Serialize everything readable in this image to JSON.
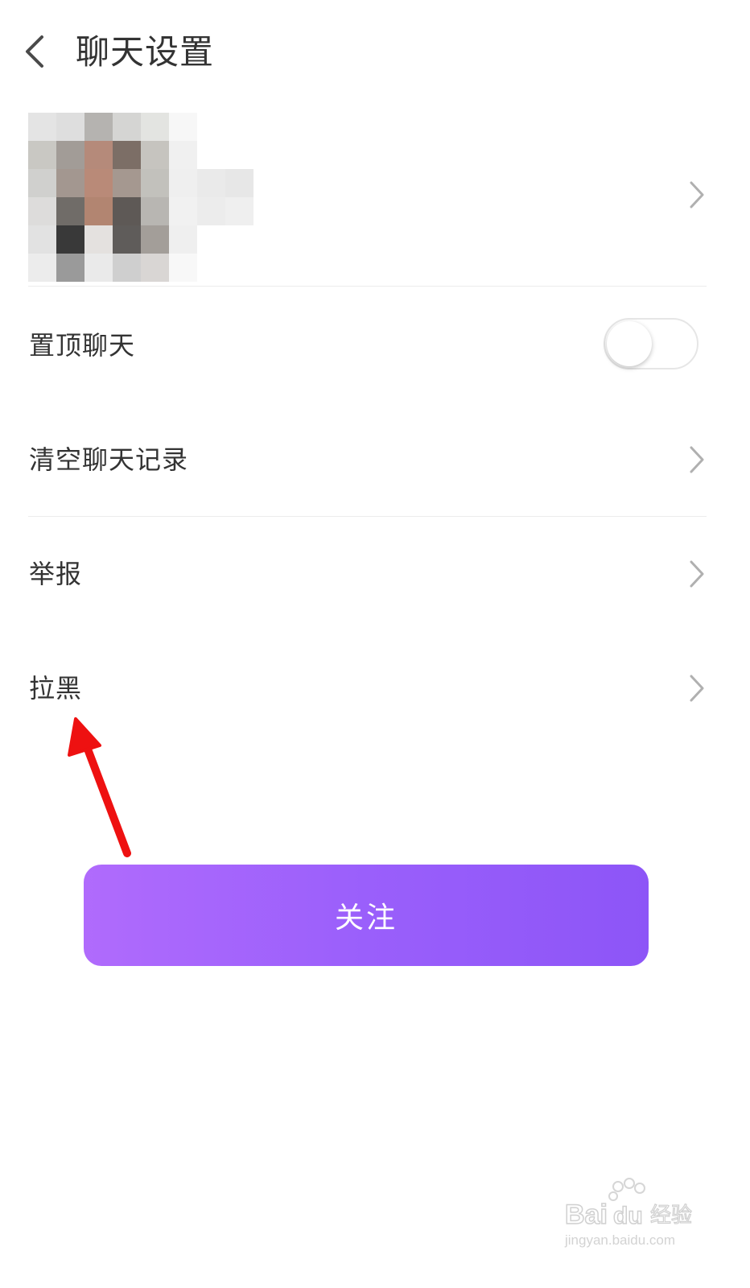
{
  "header": {
    "title": "聊天设置",
    "back_icon": "chevron-left-icon"
  },
  "profile": {
    "avatar": "pixelated-avatar",
    "name": ""
  },
  "settings": [
    {
      "label": "置顶聊天",
      "control": "toggle",
      "on": false
    },
    {
      "label": "清空聊天记录",
      "control": "chevron"
    },
    {
      "label": "举报",
      "control": "chevron"
    },
    {
      "label": "拉黑",
      "control": "chevron"
    }
  ],
  "follow_button": {
    "label": "关注",
    "gradient_start": "#b06bfc",
    "gradient_end": "#8d55f7"
  },
  "annotation": {
    "color": "#ee1111",
    "target": "拉黑"
  },
  "watermark": {
    "brand": "Baidu经验",
    "url": "jingyan.baidu.com"
  }
}
